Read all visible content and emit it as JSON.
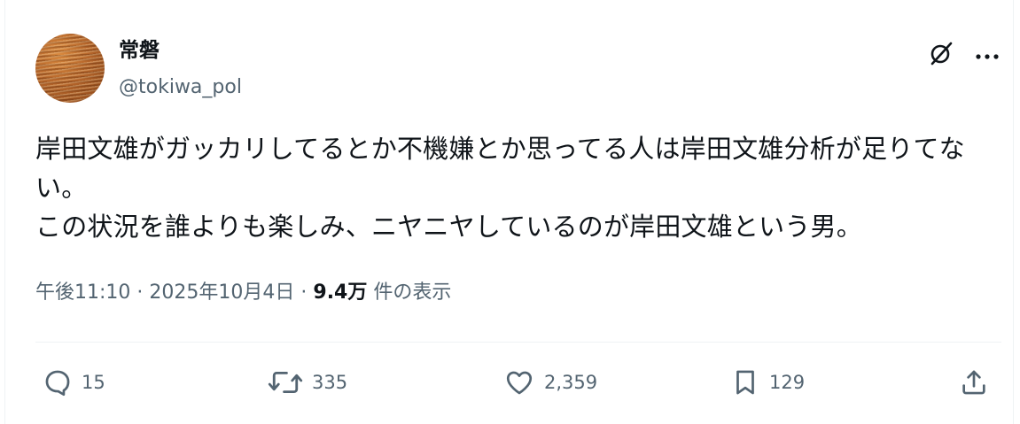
{
  "author": {
    "display_name": "常磐",
    "handle": "@tokiwa_pol"
  },
  "tweet": {
    "text": "岸田文雄がガッカリしてるとか不機嫌とか思ってる人は岸田文雄分析が足りてない。\nこの状況を誰よりも楽しみ、ニヤニヤしているのが岸田文雄という男。"
  },
  "meta": {
    "time": "午後11:10",
    "separator": "·",
    "date": "2025年10月4日",
    "views_count": "9.4万",
    "views_label": "件の表示"
  },
  "actions": {
    "replies": "15",
    "reposts": "335",
    "likes": "2,359",
    "bookmarks": "129"
  },
  "icons": {
    "grok": "grok-icon",
    "more": "more-icon",
    "reply": "reply-icon",
    "repost": "repost-icon",
    "like": "heart-icon",
    "bookmark": "bookmark-icon",
    "share": "share-icon"
  },
  "colors": {
    "text": "#0f1419",
    "secondary": "#536471",
    "divider": "#eff3f4"
  }
}
